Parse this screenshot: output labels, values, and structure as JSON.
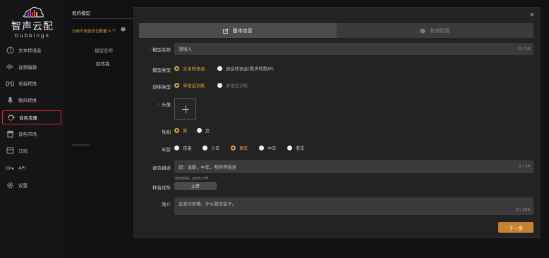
{
  "logo": {
    "title_cn": "智声云配",
    "title_en": "DubbingX",
    "wave_colors": [
      "#9b3af5",
      "#e0262a",
      "#f0a020"
    ]
  },
  "sidebar": {
    "items": [
      {
        "label": "文本转语音",
        "icon": "text-to-speech-icon"
      },
      {
        "label": "音频编辑",
        "icon": "audio-wave-icon"
      },
      {
        "label": "语音转换",
        "icon": "voice-change-icon"
      },
      {
        "label": "歌声转换",
        "icon": "song-change-icon"
      },
      {
        "label": "音色克隆",
        "icon": "voice-clone-icon",
        "active": true
      },
      {
        "label": "音色市场",
        "icon": "market-icon"
      },
      {
        "label": "订阅",
        "icon": "subscribe-icon"
      },
      {
        "label": "API",
        "icon": "key-icon"
      },
      {
        "label": "设置",
        "icon": "gear-icon"
      }
    ]
  },
  "background": {
    "tab": "我的模型",
    "count_text": "当前可用音色位数量 0 个",
    "column_header": "模型名称",
    "row_value": "回答我"
  },
  "modal": {
    "steps": [
      {
        "label": "基本信息",
        "icon": "edit-icon",
        "active": true
      },
      {
        "label": "数据配置",
        "icon": "cube-icon",
        "active": false
      }
    ],
    "fields": {
      "model_name": {
        "label": "模型名称",
        "required": true,
        "value": "请输入",
        "count": "0 / 10"
      },
      "model_type": {
        "label": "模型类型",
        "options": [
          "文本转语音",
          "语音转语音(歌声转歌声)"
        ],
        "selected": "文本转语音"
      },
      "train_type": {
        "label": "训练类型",
        "options": [
          "单语态训练",
          "多语态训练"
        ],
        "selected": "单语态训练"
      },
      "avatar": {
        "label": "头像",
        "required": true
      },
      "gender": {
        "label": "性别",
        "options": [
          "男",
          "女"
        ],
        "selected": "男"
      },
      "age": {
        "label": "年龄",
        "options": [
          "孩童",
          "少年",
          "青年",
          "中年",
          "老年"
        ],
        "selected": "青年"
      },
      "voice_desc": {
        "label": "音色描述",
        "placeholder": "如：温暖，中年，明亮等描述",
        "count": "0 / 10"
      },
      "sample": {
        "label": "样音试听",
        "hint": "试听音频请，支持大小5M",
        "button": "上传"
      },
      "intro": {
        "label": "简介",
        "placeholder": "这家伙很懒，什么都没留下。",
        "count": "0 / 150"
      }
    },
    "next_button": "下一步",
    "accent_color": "#e3a23a"
  }
}
